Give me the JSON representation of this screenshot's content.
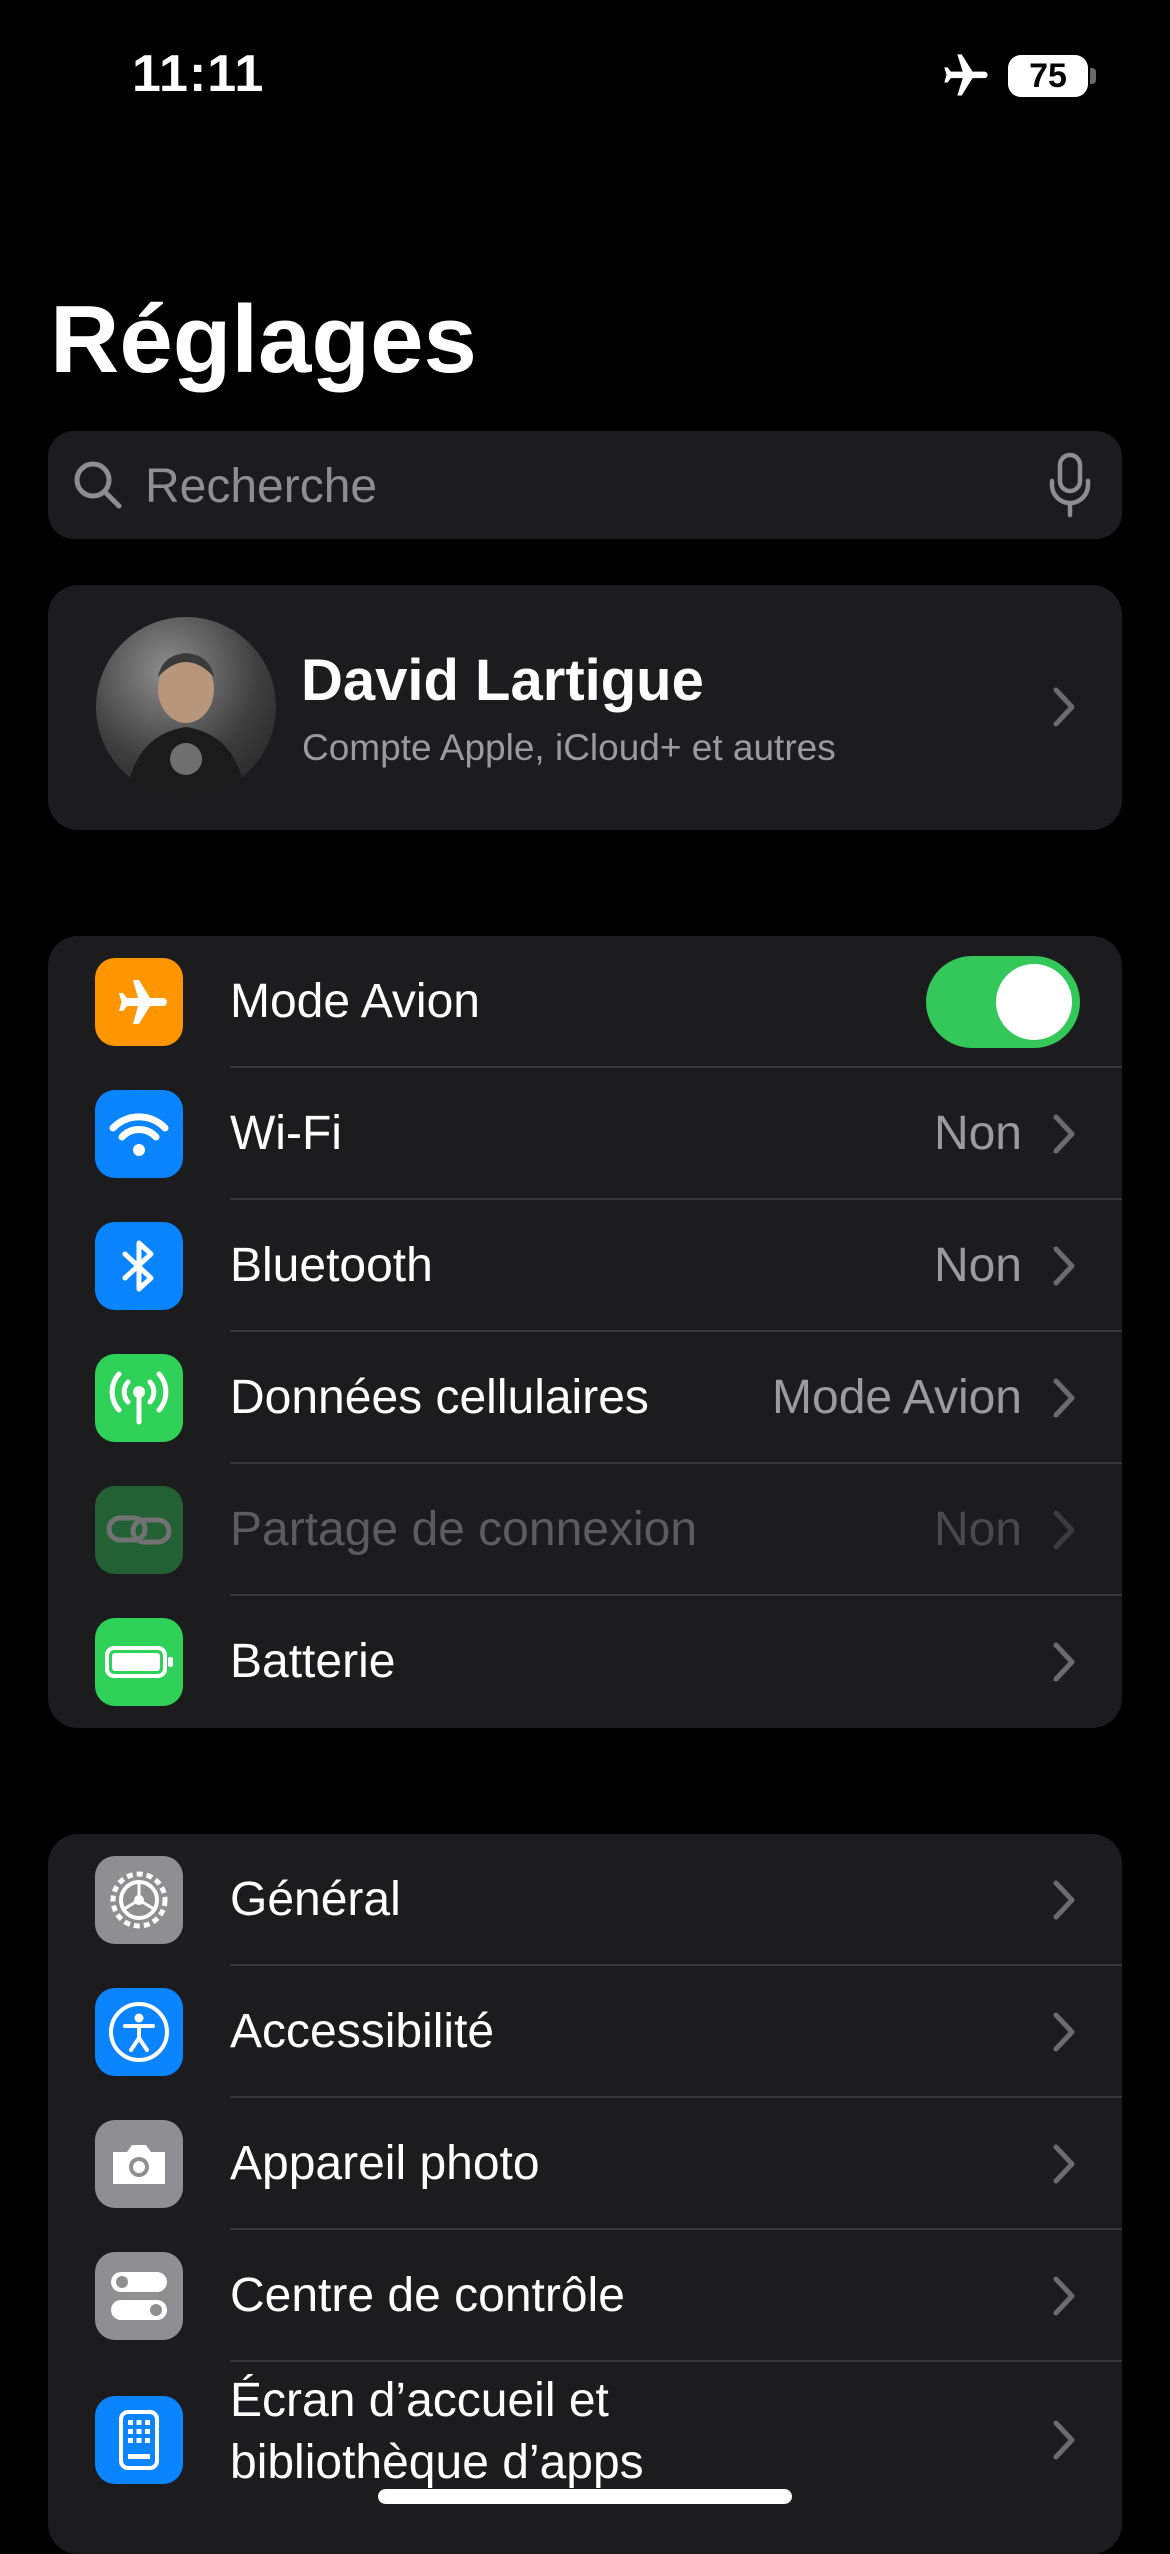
{
  "status_bar": {
    "time": "11:11",
    "battery_level": "75"
  },
  "title": "Réglages",
  "search": {
    "placeholder": "Recherche"
  },
  "profile": {
    "name": "David Lartigue",
    "subtitle": "Compte Apple, iCloud+ et autres"
  },
  "group1": [
    {
      "label": "Mode Avion",
      "toggle_on": true,
      "icon_color": "#ff9500"
    },
    {
      "label": "Wi-Fi",
      "value": "Non",
      "icon_color": "#0a84ff"
    },
    {
      "label": "Bluetooth",
      "value": "Non",
      "icon_color": "#0a84ff"
    },
    {
      "label": "Données cellulaires",
      "value": "Mode Avion",
      "icon_color": "#30d158"
    },
    {
      "label": "Partage de connexion",
      "value": "Non",
      "icon_color": "#30d158",
      "disabled": true
    },
    {
      "label": "Batterie",
      "icon_color": "#30d158"
    }
  ],
  "group2": [
    {
      "label": "Général",
      "icon_color": "#8e8e93"
    },
    {
      "label": "Accessibilité",
      "icon_color": "#0a84ff"
    },
    {
      "label": "Appareil photo",
      "icon_color": "#8e8e93"
    },
    {
      "label": "Centre de contrôle",
      "icon_color": "#8e8e93"
    },
    {
      "label": "Écran d’accueil et bibliothèque d’apps",
      "icon_color": "#0a84ff"
    }
  ]
}
